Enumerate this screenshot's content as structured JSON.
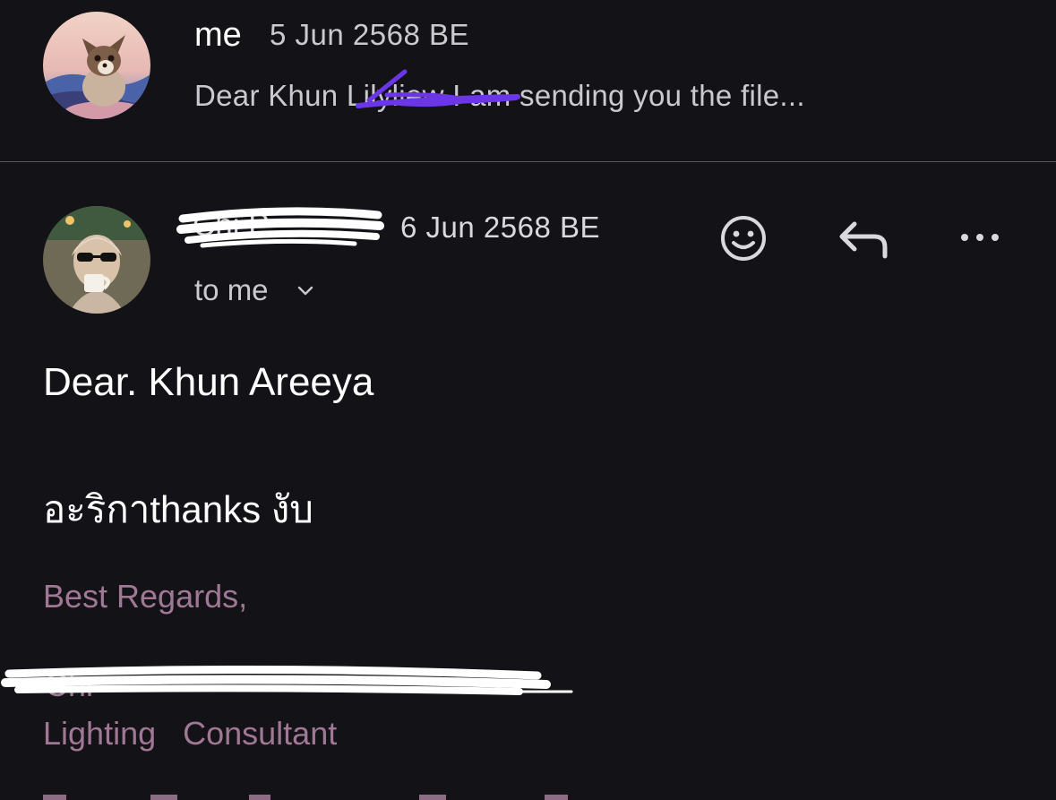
{
  "thread": {
    "message1": {
      "sender": "me",
      "date": "5 Jun 2568 BE",
      "snippet": "Dear Khun Lilyliew I am sending you the file..."
    },
    "message2": {
      "sender": "Chi  P.",
      "date": "6 Jun 2568 BE",
      "recipient_label": "to me",
      "body": {
        "greeting": "Dear. Khun Areeya",
        "line": "อะริกาthanks งับ"
      },
      "signature": {
        "closing": "Best Regards,",
        "name": "Chi",
        "title": "Lighting   Consultant"
      }
    }
  },
  "actions": {
    "emoji": "smiley-icon",
    "reply": "reply-icon",
    "more": "more-icon"
  },
  "colors": {
    "background": "#131217",
    "signature": "#a07895",
    "scribble_purple": "#6a36e8"
  }
}
